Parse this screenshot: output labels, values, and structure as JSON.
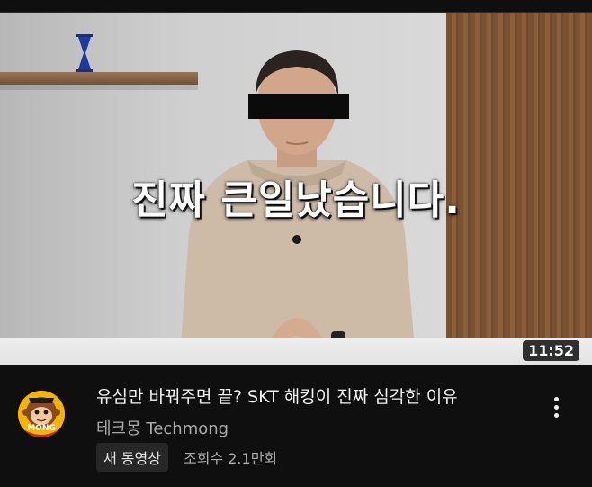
{
  "video": {
    "caption": "진짜 큰일났습니다.",
    "duration": "11:52",
    "title": "유심만 바꿔주면 끝? SKT 해킹이 진짜 심각한 이유",
    "channel": "테크몽 Techmong",
    "new_badge": "새 동영상",
    "views": "조회수 2.1만회",
    "avatar_text": "MONG"
  },
  "icons": {
    "menu": "more-vert-icon"
  },
  "colors": {
    "background": "#0f0f0f",
    "title": "#f1f1f1",
    "secondary_text": "#aaaaaa",
    "badge_bg": "#272727",
    "avatar": "#f4b400"
  }
}
